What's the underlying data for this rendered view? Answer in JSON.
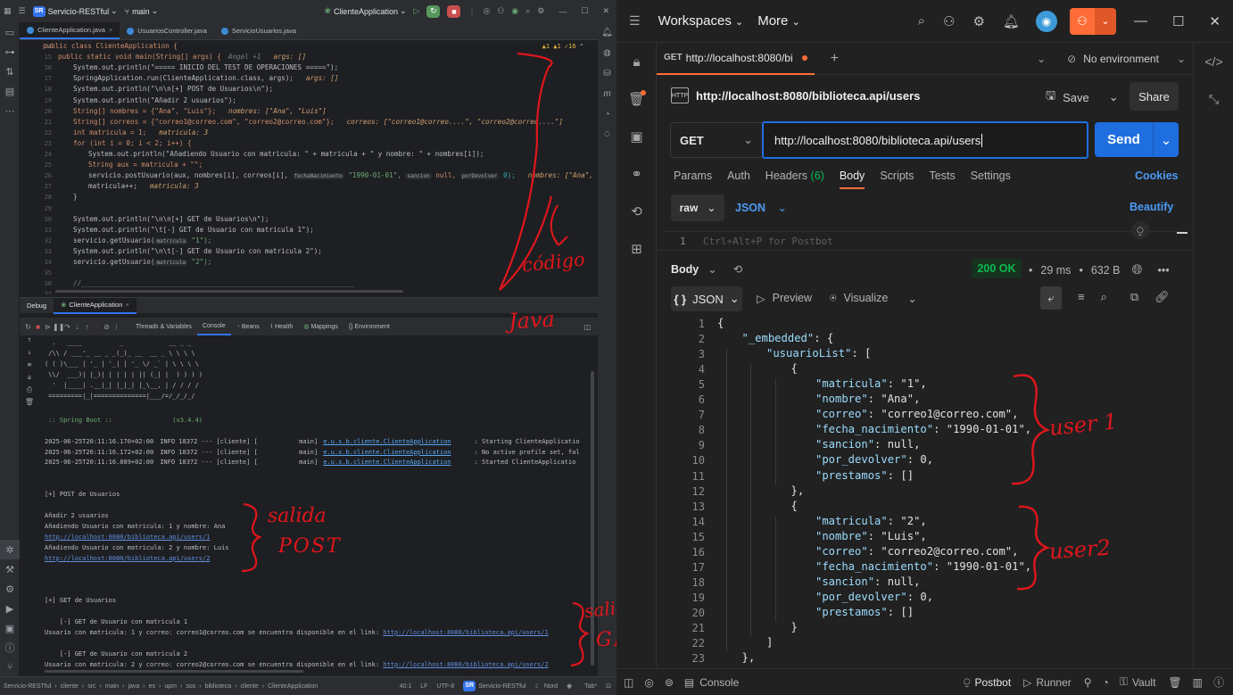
{
  "ide": {
    "project": "Servicio-RESTful",
    "project_abbr": "SR",
    "branch": "main",
    "run_config": "ClienteApplication",
    "tabs": [
      "ClienteApplication.java",
      "UsuariosController.java",
      "ServicioUsuarios.java"
    ],
    "inspections": "▲1 ▲1 ✓16",
    "code_lines": [
      {
        "n": "14",
        "t": "public class ClienteApplication {"
      },
      {
        "n": "15",
        "t": "public static void main(String[] args) {",
        "hint": "args: []",
        "author": "Angel +1"
      },
      {
        "n": "16",
        "t": "System.out.println(\"===== INICIO DEL TEST DE OPERACIONES =====\");"
      },
      {
        "n": "17",
        "t": "SpringApplication.run(ClienteApplication.class, args);",
        "hint": "args: []"
      },
      {
        "n": "18",
        "t": "System.out.println(\"\\n\\n[+] POST de Usuarios\\n\");"
      },
      {
        "n": "19",
        "t": "System.out.println(\"Añadir 2 usuarios\");"
      },
      {
        "n": "20",
        "t": "String[] nombres = {\"Ana\", \"Luis\"};",
        "hint": "nombres: [\"Ana\", \"Luis\"]"
      },
      {
        "n": "21",
        "t": "String[] correos = {\"correo1@correo.com\", \"correo2@correo.com\"};",
        "hint": "correos: [\"correo1@correo....\", \"correo2@correo....\"]"
      },
      {
        "n": "22",
        "t": "int matricula = 1;",
        "hint": "matricula: 3"
      },
      {
        "n": "23",
        "t": "for (int i = 0; i < 2; i++) {"
      },
      {
        "n": "24",
        "t": "System.out.println(\"Añadiendo Usuario con matricula: \" + matricula + \" y nombre: \" + nombres[i]);"
      },
      {
        "n": "25",
        "t": "String aux = matricula + \"\";"
      },
      {
        "n": "26",
        "t": "servicio.postUsuario(aux, nombres[i], correos[i], \"1990-01-01\", null, 0);",
        "p1": "fechaNacimiento",
        "p2": "sancion",
        "p3": "porDevolver",
        "hint": "nombres: [\"Ana\", \"Lu"
      },
      {
        "n": "27",
        "t": "matricula++;",
        "hint": "matricula: 3"
      },
      {
        "n": "28",
        "t": "}"
      },
      {
        "n": "29",
        "t": ""
      },
      {
        "n": "30",
        "t": "System.out.println(\"\\n\\n[+] GET de Usuarios\\n\");"
      },
      {
        "n": "31",
        "t": "System.out.println(\"\\t[-] GET de Usuario con matricula 1\");"
      },
      {
        "n": "32",
        "t": "servicio.getUsuario(\"1\");",
        "p1": "matricula"
      },
      {
        "n": "33",
        "t": "System.out.println(\"\\n\\t[-] GET de Usuario con matricula 2\");"
      },
      {
        "n": "34",
        "t": "servicio.getUsuario(\"2\");",
        "p1": "matricula"
      },
      {
        "n": "35",
        "t": ""
      },
      {
        "n": "36",
        "t": "//___________________________________________________________________"
      },
      {
        "n": "37",
        "t": ""
      }
    ],
    "debug_label": "Debug",
    "debug_session": "ClienteApplication",
    "debug_tabs": [
      "Threads & Variables",
      "Console",
      "Beans",
      "Health",
      "Mappings",
      "Environment"
    ],
    "banner": [
      "  .   ____          _            __ _ _",
      " /\\\\ / ___'_ __ _ _(_)_ __  __ _ \\ \\ \\ \\",
      "( ( )\\___ | '_ | '_| | '_ \\/ _` | \\ \\ \\ \\",
      " \\\\/  ___)| |_)| | | | | || (_| |  ) ) ) )",
      "  '  |____| .__|_| |_|_| |_\\__, | / / / /",
      " =========|_|==============|___/=/_/_/_/"
    ],
    "spring_boot": " :: Spring Boot ::                (v3.4.4)",
    "log_lines": [
      {
        "ts": "2025-06-25T20:11:16.170+02:00",
        "lvl": "INFO 18372 --- [cliente] [           main]",
        "cls": "e.u.s.b.cliente.ClienteApplication",
        "msg": ": Starting ClienteApplicatio"
      },
      {
        "ts": "2025-06-25T20:11:16.172+02:00",
        "lvl": "INFO 18372 --- [cliente] [           main]",
        "cls": "e.u.s.b.cliente.ClienteApplication",
        "msg": ": No active profile set, fal"
      },
      {
        "ts": "2025-06-25T20:11:16.889+02:00",
        "lvl": "INFO 18372 --- [cliente] [           main]",
        "cls": "e.u.s.b.cliente.ClienteApplication",
        "msg": ": Started ClienteApplicatio"
      }
    ],
    "out": {
      "post_header": "[+] POST de Usuarios",
      "add2": "Añadir 2 usuarios",
      "adding1": "Añadiendo Usuario con matricula: 1 y nombre: Ana",
      "link1": "http://localhost:8080/biblioteca.api/users/1",
      "adding2": "Añadiendo Usuario con matricula: 2 y nombre: Luis",
      "link2": "http://localhost:8080/biblioteca.api/users/2",
      "get_header": "[+] GET de Usuarios",
      "get1": "    [-] GET de Usuario con matricula 1",
      "avail1": "Usuario con matricula: 1 y correo: correo1@correo.com se encuentra disponible en el link: ",
      "get2": "    [-] GET de Usuario con matricula 2",
      "avail2": "Usuario con matricula: 2 y correo: correo2@correo.com se encuentra disponible en el link: "
    },
    "status": {
      "crumbs": [
        "Servicio-RESTful",
        "cliente",
        "src",
        "main",
        "java",
        "es",
        "upm",
        "sos",
        "biblioteca",
        "cliente",
        "ClienteApplication"
      ],
      "pos": "40:1",
      "lf": "LF",
      "enc": "UTF-8",
      "project": "Servicio-RESTful",
      "theme": "Nord",
      "tab": "Tab*"
    },
    "annotations": {
      "codigo": "código",
      "java": "Java",
      "salida1": "salida",
      "post": "POST",
      "salida2": "salida",
      "get": "GET"
    }
  },
  "postman": {
    "workspaces": "Workspaces",
    "more": "More",
    "tab_method": "GET",
    "tab_url": "http://localhost:8080/bi",
    "environment": "No environment",
    "request_title": "http://localhost:8080/biblioteca.api/users",
    "save": "Save",
    "share": "Share",
    "method": "GET",
    "url": "http://localhost:8080/biblioteca.api/users",
    "send": "Send",
    "req_tabs": [
      "Params",
      "Auth",
      "Headers",
      "Body",
      "Scripts",
      "Tests",
      "Settings"
    ],
    "headers_count": "(6)",
    "cookies": "Cookies",
    "body_mode": "raw",
    "body_lang": "JSON",
    "beautify": "Beautify",
    "req_line_no": "1",
    "req_placeholder": "Ctrl+Alt+P for Postbot",
    "resp_label": "Body",
    "status": "200 OK",
    "time": "29 ms",
    "size": "632 B",
    "resp_format": "JSON",
    "preview": "Preview",
    "visualize": "Visualize",
    "json_lines": [
      {
        "n": "1",
        "indent": 0,
        "t": "{"
      },
      {
        "n": "2",
        "indent": 1,
        "k": "\"_embedded\"",
        "t": ": {"
      },
      {
        "n": "3",
        "indent": 2,
        "k": "\"usuarioList\"",
        "t": ": ["
      },
      {
        "n": "4",
        "indent": 3,
        "t": "{"
      },
      {
        "n": "5",
        "indent": 4,
        "k": "\"matricula\"",
        "t": ": \"1\","
      },
      {
        "n": "6",
        "indent": 4,
        "k": "\"nombre\"",
        "t": ": \"Ana\","
      },
      {
        "n": "7",
        "indent": 4,
        "k": "\"correo\"",
        "t": ": \"correo1@correo.com\","
      },
      {
        "n": "8",
        "indent": 4,
        "k": "\"fecha_nacimiento\"",
        "t": ": \"1990-01-01\","
      },
      {
        "n": "9",
        "indent": 4,
        "k": "\"sancion\"",
        "t": ": null,"
      },
      {
        "n": "10",
        "indent": 4,
        "k": "\"por_devolver\"",
        "t": ": 0,"
      },
      {
        "n": "11",
        "indent": 4,
        "k": "\"prestamos\"",
        "t": ": []"
      },
      {
        "n": "12",
        "indent": 3,
        "t": "},"
      },
      {
        "n": "13",
        "indent": 3,
        "t": "{"
      },
      {
        "n": "14",
        "indent": 4,
        "k": "\"matricula\"",
        "t": ": \"2\","
      },
      {
        "n": "15",
        "indent": 4,
        "k": "\"nombre\"",
        "t": ": \"Luis\","
      },
      {
        "n": "16",
        "indent": 4,
        "k": "\"correo\"",
        "t": ": \"correo2@correo.com\","
      },
      {
        "n": "17",
        "indent": 4,
        "k": "\"fecha_nacimiento\"",
        "t": ": \"1990-01-01\","
      },
      {
        "n": "18",
        "indent": 4,
        "k": "\"sancion\"",
        "t": ": null,"
      },
      {
        "n": "19",
        "indent": 4,
        "k": "\"por_devolver\"",
        "t": ": 0,"
      },
      {
        "n": "20",
        "indent": 4,
        "k": "\"prestamos\"",
        "t": ": []"
      },
      {
        "n": "21",
        "indent": 3,
        "t": "}"
      },
      {
        "n": "22",
        "indent": 2,
        "t": "]"
      },
      {
        "n": "23",
        "indent": 1,
        "t": "},"
      }
    ],
    "annotations": {
      "user1": "user 1",
      "user2": "user2"
    },
    "bottom": {
      "console": "Console",
      "postbot": "Postbot",
      "runner": "Runner",
      "vault": "Vault"
    },
    "colors": {
      "accent": "#ff6c37",
      "send": "#1f6ee0",
      "ok": "#0cbb52"
    }
  }
}
